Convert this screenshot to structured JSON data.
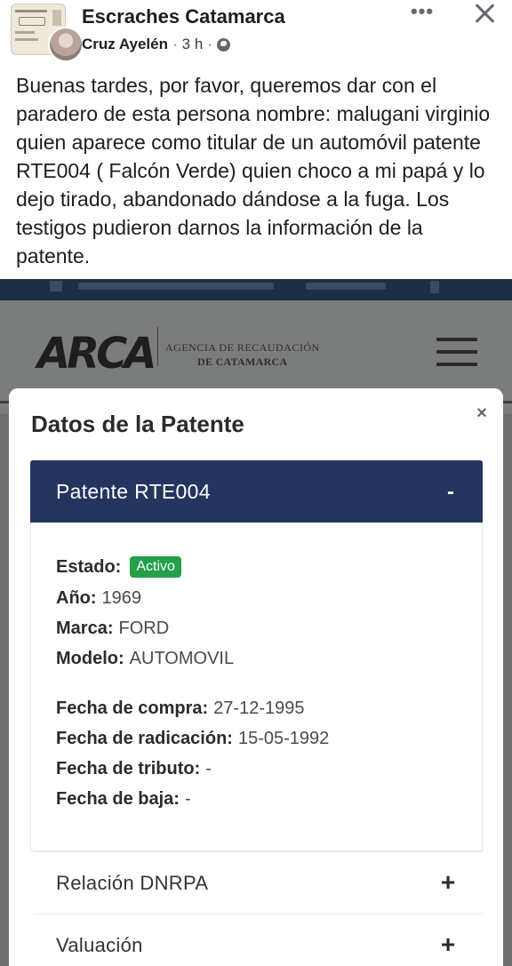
{
  "post": {
    "group_name": "Escraches Catamarca",
    "author": "Cruz Ayelén",
    "separator": "·",
    "time": "3 h",
    "more_glyph": "•••",
    "text": "Buenas tardes, por favor, queremos dar con el paradero de esta persona nombre: malugani virginio quien aparece como titular de un automóvil patente RTE004 ( Falcón Verde) quien choco a mi papá y lo dejo tirado, abandonado dándose a la  fuga. Los testigos pudieron darnos la información de la patente."
  },
  "site": {
    "logo": "ARCA",
    "agency_line1": "AGENCIA DE RECAUDACIÓN",
    "agency_line2": "DE CATAMARCA"
  },
  "modal": {
    "title": "Datos de la Patente",
    "close_glyph": "×",
    "plate_header": "Patente RTE004",
    "collapse_glyph": "-",
    "fields": {
      "estado_label": "Estado:",
      "estado_value": "Activo",
      "anio_label": "Año:",
      "anio_value": "1969",
      "marca_label": "Marca:",
      "marca_value": "FORD",
      "modelo_label": "Modelo:",
      "modelo_value": "AUTOMOVIL",
      "fecha_compra_label": "Fecha de compra:",
      "fecha_compra_value": "27-12-1995",
      "fecha_radicacion_label": "Fecha de radicación:",
      "fecha_radicacion_value": "15-05-1992",
      "fecha_tributo_label": "Fecha de tributo:",
      "fecha_tributo_value": "-",
      "fecha_baja_label": "Fecha de baja:",
      "fecha_baja_value": "-"
    },
    "sections": [
      {
        "label": "Relación DNRPA",
        "glyph": "+"
      },
      {
        "label": "Valuación",
        "glyph": "+"
      }
    ]
  },
  "colors": {
    "accordion_header": "#24345f",
    "active_badge": "#23a049",
    "overlay": "#6f7070"
  }
}
